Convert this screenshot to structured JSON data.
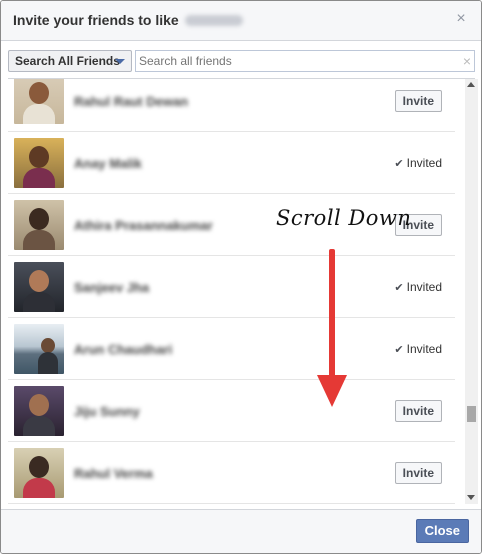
{
  "dialog": {
    "title": "Invite your friends to like",
    "close_glyph": "×"
  },
  "search": {
    "filter_label": "Search All Friends",
    "placeholder": "Search all friends",
    "clear_glyph": "×"
  },
  "friends": [
    {
      "name": "Rahul Raut Dewan",
      "status": "invite",
      "action_label": "Invite"
    },
    {
      "name": "Anay Malik",
      "status": "invited",
      "status_label": "Invited",
      "check_glyph": "✔"
    },
    {
      "name": "Athira Prasannakumar",
      "status": "invite",
      "action_label": "Invite"
    },
    {
      "name": "Sanjeev Jha",
      "status": "invited",
      "status_label": "Invited",
      "check_glyph": "✔"
    },
    {
      "name": "Arun Chaudhari",
      "status": "invited",
      "status_label": "Invited",
      "check_glyph": "✔"
    },
    {
      "name": "Jiju Sunny",
      "status": "invite",
      "action_label": "Invite"
    },
    {
      "name": "Rahul Verma",
      "status": "invite",
      "action_label": "Invite"
    }
  ],
  "annotation": {
    "text": "Scroll Down",
    "color": "#e53935"
  },
  "footer": {
    "close_label": "Close"
  },
  "colors": {
    "primary_button": "#5b7bb7",
    "header_bg": "#f6f7f9"
  }
}
